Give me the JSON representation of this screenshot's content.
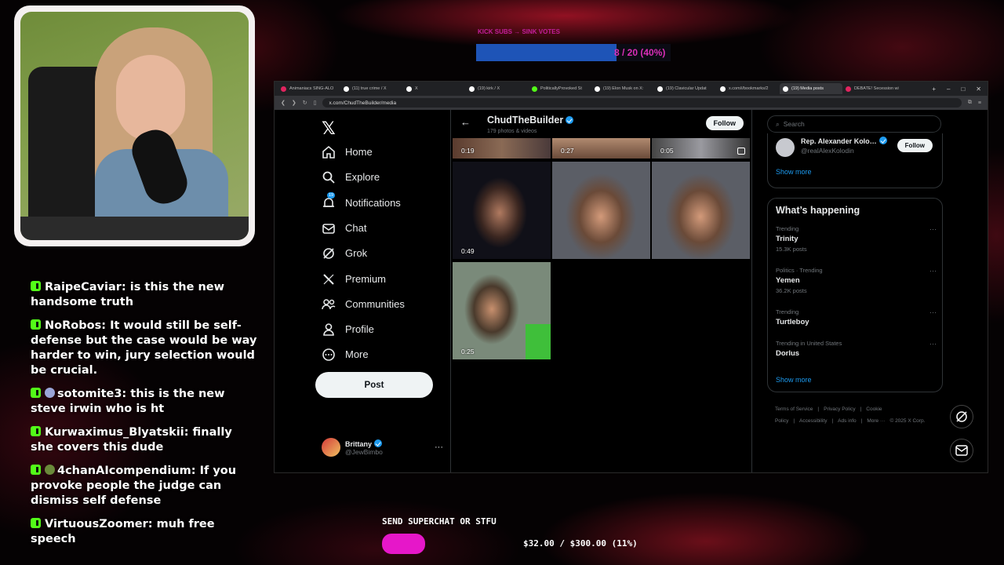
{
  "overlay": {
    "top_label": "KICK SUBS → SINK VOTES",
    "top_progress_text": "8 / 20 (40%)",
    "top_progress_fraction": 0.4,
    "superchat_label": "SEND SUPERCHAT OR STFU",
    "superchat_amount": "$32.00 / $300.00 (11%)",
    "superchat_fraction": 0.11
  },
  "chat": [
    {
      "user": "RaipeCaviar",
      "text": "is this the new handsome truth",
      "badge": null
    },
    {
      "user": "NoRobos",
      "text": "It would still be self-defense but the case would be way harder to win, jury selection would be crucial.",
      "badge": null
    },
    {
      "user": "sotomite3",
      "text": "this is the new steve irwin who is ht",
      "badge": "#9aa6d8"
    },
    {
      "user": "Kurwaximus_Blyatskii",
      "text": "finally she covers this dude",
      "badge": null
    },
    {
      "user": "4chanAIcompendium",
      "text": "If you provoke people the judge can dismiss self defense",
      "badge": "#6a8a3a"
    },
    {
      "user": "VirtuousZoomer",
      "text": "muh free speech",
      "badge": null
    }
  ],
  "browser": {
    "tabs": [
      {
        "label": "Animaniacs SING-ALO",
        "color": "#e0245e",
        "active": false
      },
      {
        "label": "(11) true crime / X",
        "color": "#ffffff",
        "active": false
      },
      {
        "label": "X",
        "color": "#ffffff",
        "active": false
      },
      {
        "label": "(19) kirk / X",
        "color": "#ffffff",
        "active": false
      },
      {
        "label": "PoliticallyProvoked St",
        "color": "#53fc18",
        "active": false
      },
      {
        "label": "(19) Elon Musk on X:",
        "color": "#ffffff",
        "active": false
      },
      {
        "label": "(19) Clavicular Updat",
        "color": "#ffffff",
        "active": false
      },
      {
        "label": "x.com/i/bookmarks/2",
        "color": "#ffffff",
        "active": false
      },
      {
        "label": "(19) Media posts",
        "color": "#ffffff",
        "active": true
      },
      {
        "label": "DEBATE! Secession wi",
        "color": "#e0245e",
        "active": false
      }
    ],
    "url": "x.com/ChudTheBuilder/media"
  },
  "x": {
    "nav": [
      {
        "label": "Home",
        "icon": "home-icon"
      },
      {
        "label": "Explore",
        "icon": "search-icon"
      },
      {
        "label": "Notifications",
        "icon": "bell-icon",
        "badge": "19"
      },
      {
        "label": "Chat",
        "icon": "mail-icon"
      },
      {
        "label": "Grok",
        "icon": "grok-icon"
      },
      {
        "label": "Premium",
        "icon": "x-icon"
      },
      {
        "label": "Communities",
        "icon": "people-icon"
      },
      {
        "label": "Profile",
        "icon": "person-icon"
      },
      {
        "label": "More",
        "icon": "more-circle-icon"
      }
    ],
    "post_label": "Post",
    "user": {
      "name": "Brittany",
      "handle": "@JewBimbo"
    },
    "profile": {
      "name": "ChudTheBuilder",
      "subtitle": "179 photos & videos",
      "follow": "Follow"
    },
    "media": [
      {
        "duration": "0:19",
        "multi": false
      },
      {
        "duration": "0:27",
        "multi": false
      },
      {
        "duration": "0:05",
        "multi": true
      },
      {
        "duration": "0:49",
        "multi": false
      },
      {
        "duration": "",
        "multi": false
      },
      {
        "duration": "",
        "multi": false
      },
      {
        "duration": "0:25",
        "multi": false
      }
    ],
    "search_placeholder": "Search",
    "who_to_follow": {
      "name": "Rep. Alexander Kolo…",
      "handle": "@realAlexKolodin",
      "follow": "Follow"
    },
    "show_more": "Show more",
    "happening_title": "What’s happening",
    "trends": [
      {
        "context": "Trending",
        "name": "Trinity",
        "count": "15.3K posts"
      },
      {
        "context": "Politics · Trending",
        "name": "Yemen",
        "count": "36.2K posts"
      },
      {
        "context": "Trending",
        "name": "Turtleboy",
        "count": ""
      },
      {
        "context": "Trending in United States",
        "name": "Dorlus",
        "count": ""
      }
    ],
    "footer": [
      "Terms of Service",
      "|",
      "Privacy Policy",
      "|",
      "Cookie Policy",
      "|",
      "Accessibility",
      "|",
      "Ads info",
      "|",
      "More ···",
      "© 2025 X Corp."
    ]
  }
}
